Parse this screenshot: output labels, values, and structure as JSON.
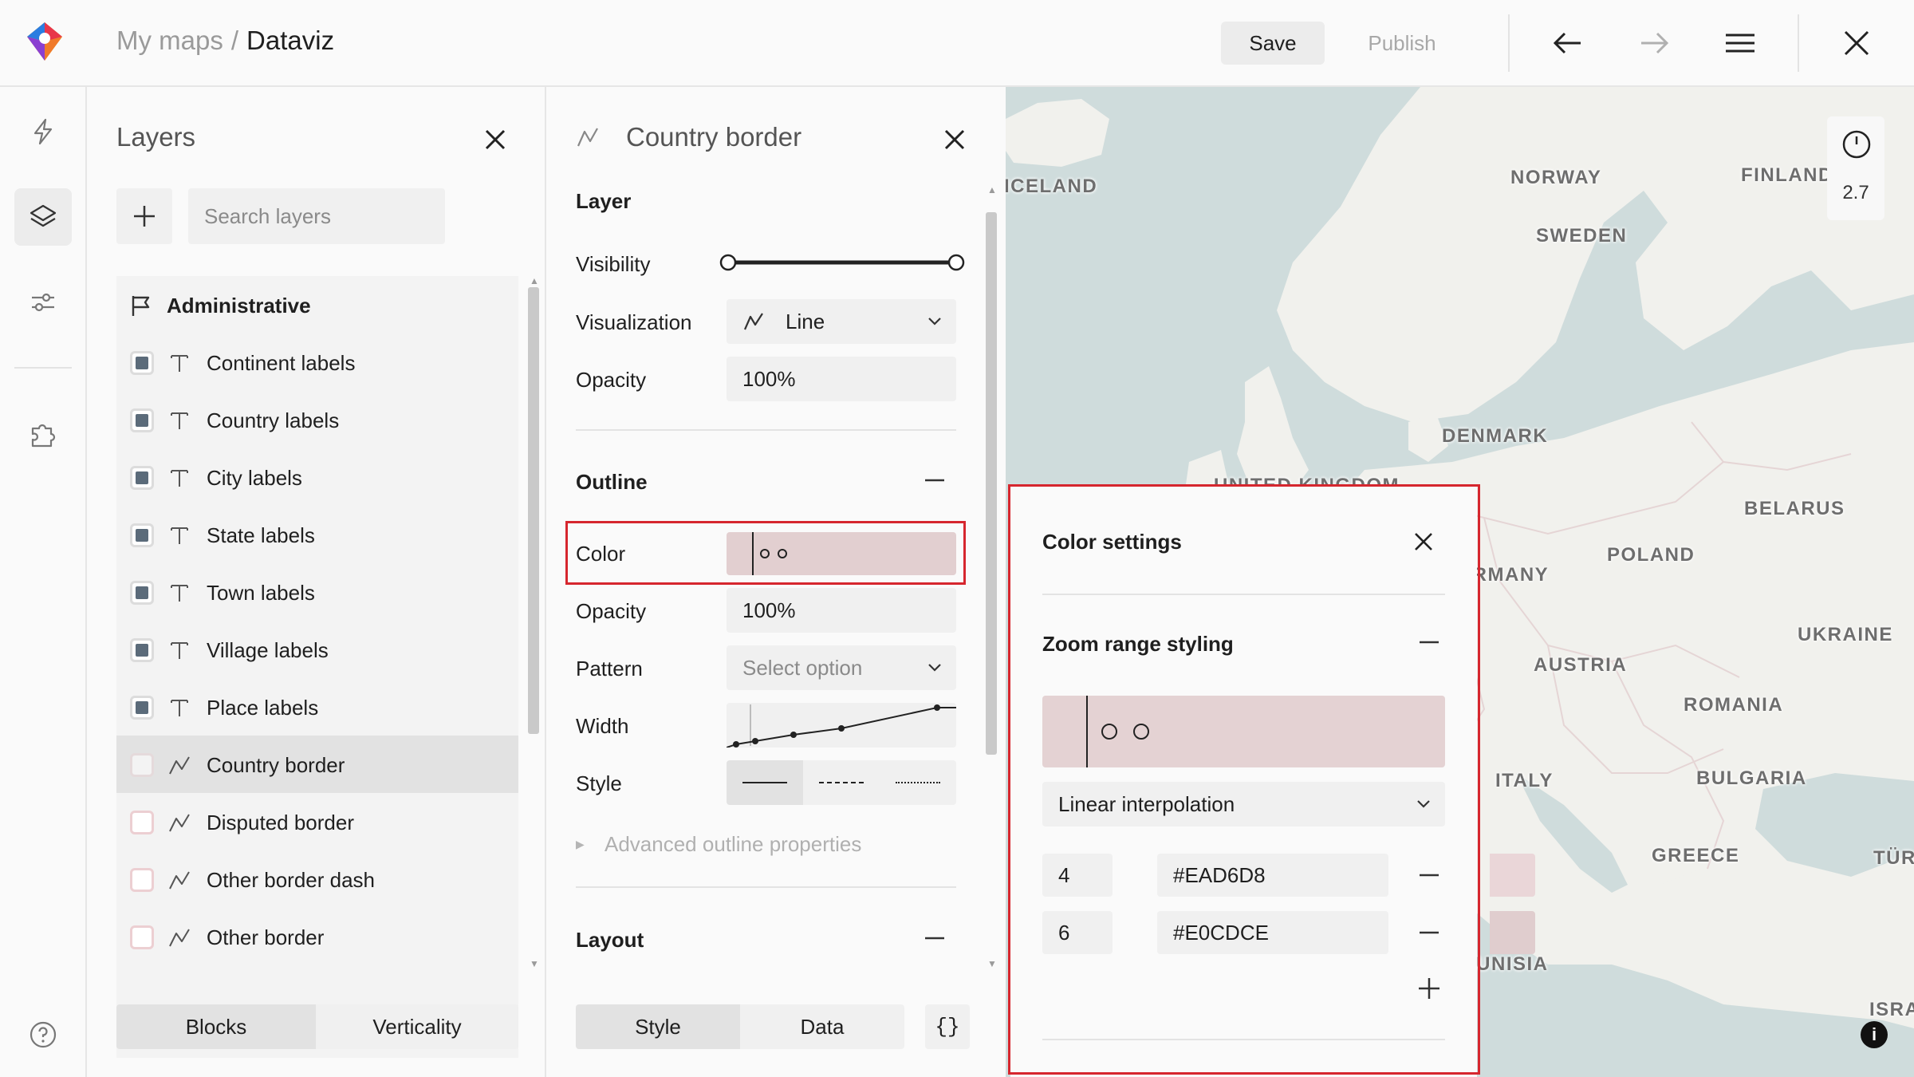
{
  "header": {
    "breadcrumb_root": "My maps",
    "breadcrumb_separator": "/",
    "breadcrumb_current": "Dataviz",
    "save_label": "Save",
    "publish_label": "Publish",
    "icons": [
      "back-arrow-icon",
      "forward-arrow-icon",
      "menu-icon",
      "close-icon"
    ]
  },
  "rail": {
    "items": [
      "lightning-icon",
      "layers-icon",
      "sliders-icon",
      "puzzle-icon"
    ],
    "active": "layers-icon",
    "help": "help-icon"
  },
  "layers_panel": {
    "title": "Layers",
    "search_placeholder": "Search layers",
    "group": "Administrative",
    "items": [
      {
        "label": "Continent labels",
        "type": "text",
        "checked": true
      },
      {
        "label": "Country labels",
        "type": "text",
        "checked": true
      },
      {
        "label": "City labels",
        "type": "text",
        "checked": true
      },
      {
        "label": "State labels",
        "type": "text",
        "checked": true
      },
      {
        "label": "Town labels",
        "type": "text",
        "checked": true
      },
      {
        "label": "Village labels",
        "type": "text",
        "checked": true
      },
      {
        "label": "Place labels",
        "type": "text",
        "checked": true
      },
      {
        "label": "Country border",
        "type": "line",
        "checked": false,
        "selected": true
      },
      {
        "label": "Disputed border",
        "type": "line",
        "checked": false
      },
      {
        "label": "Other border dash",
        "type": "line",
        "checked": false
      },
      {
        "label": "Other border",
        "type": "line",
        "checked": false
      }
    ],
    "tabs": [
      "Blocks",
      "Verticality"
    ],
    "active_tab": "Blocks"
  },
  "props_panel": {
    "title": "Country border",
    "layer_section": "Layer",
    "visibility_label": "Visibility",
    "visualization_label": "Visualization",
    "visualization_value": "Line",
    "opacity_label": "Opacity",
    "opacity_value": "100%",
    "outline_section": "Outline",
    "color_label": "Color",
    "outline_opacity_label": "Opacity",
    "outline_opacity_value": "100%",
    "pattern_label": "Pattern",
    "pattern_placeholder": "Select option",
    "width_label": "Width",
    "style_label": "Style",
    "style_options": [
      "solid",
      "dashed",
      "dotted"
    ],
    "advanced_label": "Advanced outline properties",
    "layout_section": "Layout",
    "tabs": [
      "Style",
      "Data"
    ],
    "active_tab": "Style",
    "code_label": "{}"
  },
  "map": {
    "labels": [
      "ICELAND",
      "NORWAY",
      "FINLAND",
      "SWEDEN",
      "DENMARK",
      "UNITED KINGDOM",
      "BELARUS",
      "POLAND",
      "GERMANY",
      "UKRAINE",
      "AUSTRIA",
      "ROMANIA",
      "ITALY",
      "BULGARIA",
      "GREECE",
      "TÜR",
      "ISRA",
      "TUNISIA"
    ],
    "zoom": "2.7",
    "colors": {
      "water": "#cfdcdc",
      "land": "#f1f1ed"
    }
  },
  "color_settings": {
    "title": "Color settings",
    "subtitle": "Zoom range styling",
    "interpolation": "Linear interpolation",
    "stops": [
      {
        "zoom": "4",
        "color": "#EAD6D8"
      },
      {
        "zoom": "6",
        "color": "#E0CDCE"
      }
    ]
  },
  "colors": {
    "highlight": "#d6262e",
    "swatch": "#e2cfd0"
  }
}
